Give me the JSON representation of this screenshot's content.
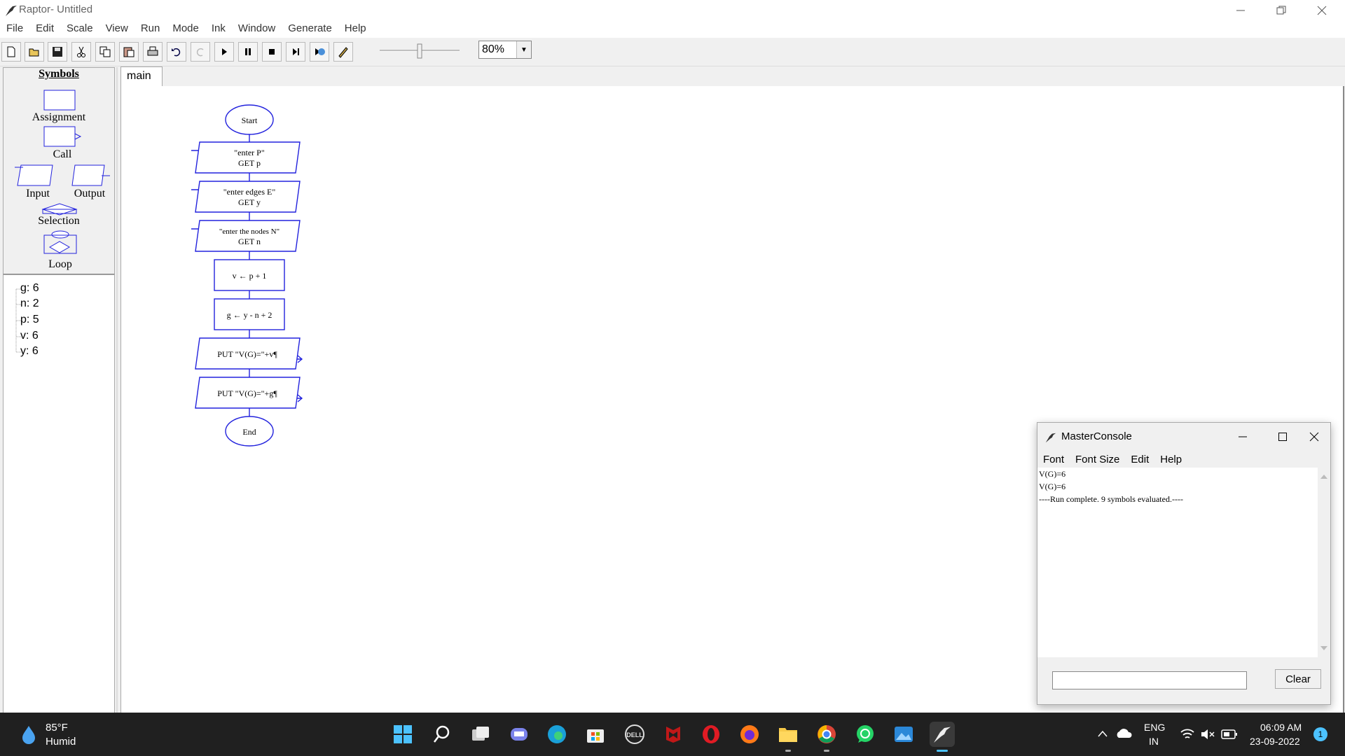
{
  "window": {
    "title": "Raptor- Untitled",
    "controls": [
      "minimize",
      "restore",
      "close"
    ]
  },
  "menu": [
    "File",
    "Edit",
    "Scale",
    "View",
    "Run",
    "Mode",
    "Ink",
    "Window",
    "Generate",
    "Help"
  ],
  "toolbar": {
    "buttons": [
      "new-icon",
      "open-icon",
      "save-icon",
      "cut-icon",
      "copy-icon",
      "paste-icon",
      "print-icon",
      "undo-icon",
      "redo-icon",
      "play-icon",
      "pause-icon",
      "stop-icon",
      "step-icon",
      "test-server-icon",
      "pen-icon"
    ],
    "zoom": "80%",
    "speed_level": 0.5
  },
  "symbols": {
    "title": "Symbols",
    "items": [
      "Assignment",
      "Call",
      "Input",
      "Output",
      "Selection",
      "Loop"
    ]
  },
  "variables": [
    "g: 6",
    "n: 2",
    "p: 5",
    "v: 6",
    "y: 6"
  ],
  "tabs": [
    "main"
  ],
  "flowchart": {
    "start": "Start",
    "input1_prompt": "\"enter P\"",
    "input1_get": "GET p",
    "input2_prompt": "\"enter edges E\"",
    "input2_get": "GET y",
    "input3_prompt": "\"enter the nodes N\"",
    "input3_get": "GET n",
    "assign1": "v ← p + 1",
    "assign2": "g ← y - n + 2",
    "output1": "PUT \"V(G)=\"+v¶",
    "output2": "PUT \"V(G)=\"+g¶",
    "end": "End"
  },
  "console": {
    "title": "MasterConsole",
    "menu": [
      "Font",
      "Font Size",
      "Edit",
      "Help"
    ],
    "lines": [
      "V(G)=6",
      "V(G)=6",
      "----Run complete.  9 symbols evaluated.----"
    ],
    "input_value": "",
    "clear_label": "Clear"
  },
  "taskbar": {
    "weather_temp": "85°F",
    "weather_desc": "Humid",
    "lang1": "ENG",
    "lang2": "IN",
    "time": "06:09 AM",
    "date": "23-09-2022",
    "notification_count": "1",
    "apps": [
      "windows-start-icon",
      "search-icon",
      "task-view-icon",
      "teams-chat-icon",
      "edge-icon",
      "store-icon",
      "dell-icon",
      "mcafee-icon",
      "opera-icon",
      "firefox-icon",
      "file-explorer-icon",
      "chrome-icon",
      "whatsapp-icon",
      "photos-icon",
      "raptor-icon"
    ]
  }
}
